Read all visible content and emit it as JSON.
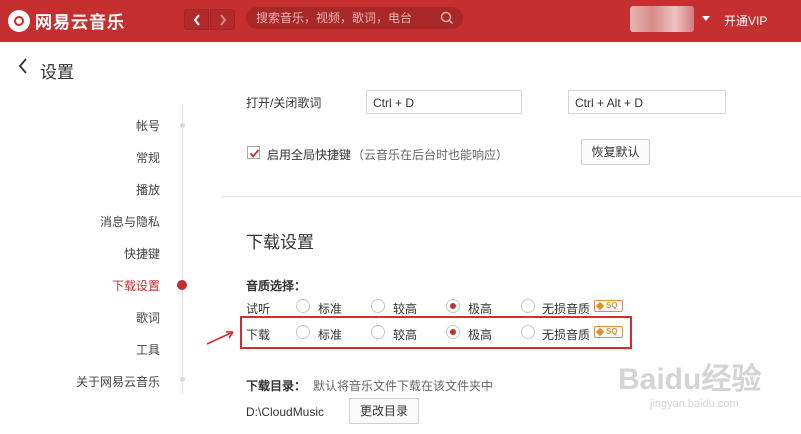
{
  "app": {
    "logo_text": "网易云音乐",
    "search_placeholder": "搜索音乐，视频，歌词，电台",
    "vip_label": "开通VIP",
    "accent_color": "#c62f2f"
  },
  "header": {
    "title": "设置"
  },
  "sidebar": {
    "items": [
      {
        "label": "帐号",
        "active": false
      },
      {
        "label": "常规",
        "active": false
      },
      {
        "label": "播放",
        "active": false
      },
      {
        "label": "消息与隐私",
        "active": false
      },
      {
        "label": "快捷键",
        "active": false
      },
      {
        "label": "下载设置",
        "active": true
      },
      {
        "label": "歌词",
        "active": false
      },
      {
        "label": "工具",
        "active": false
      },
      {
        "label": "关于网易云音乐",
        "active": false
      }
    ]
  },
  "shortcuts": {
    "row_label": "打开/关闭歌词",
    "local_key": "Ctrl + D",
    "global_key": "Ctrl + Alt + D",
    "global_enable_label": "启用全局快捷键",
    "global_enable_note": "（云音乐在后台时也能响应）",
    "global_enabled": true,
    "restore_button": "恢复默认"
  },
  "download": {
    "section_title": "下载设置",
    "quality_heading": "音质选择：",
    "quality_rows": [
      {
        "label": "试听",
        "options": [
          "标准",
          "较高",
          "极高",
          "无损音质"
        ],
        "selected": "极高",
        "badge": "SQ"
      },
      {
        "label": "下载",
        "options": [
          "标准",
          "较高",
          "极高",
          "无损音质"
        ],
        "selected": "极高",
        "badge": "SQ"
      }
    ],
    "directory_heading": "下载目录：",
    "directory_note": "默认将音乐文件下载在该文件夹中",
    "directory_path": "D:\\CloudMusic",
    "change_dir_button": "更改目录"
  },
  "watermark": {
    "brand": "Baidu经验",
    "url": "jingyan.baidu.com"
  }
}
